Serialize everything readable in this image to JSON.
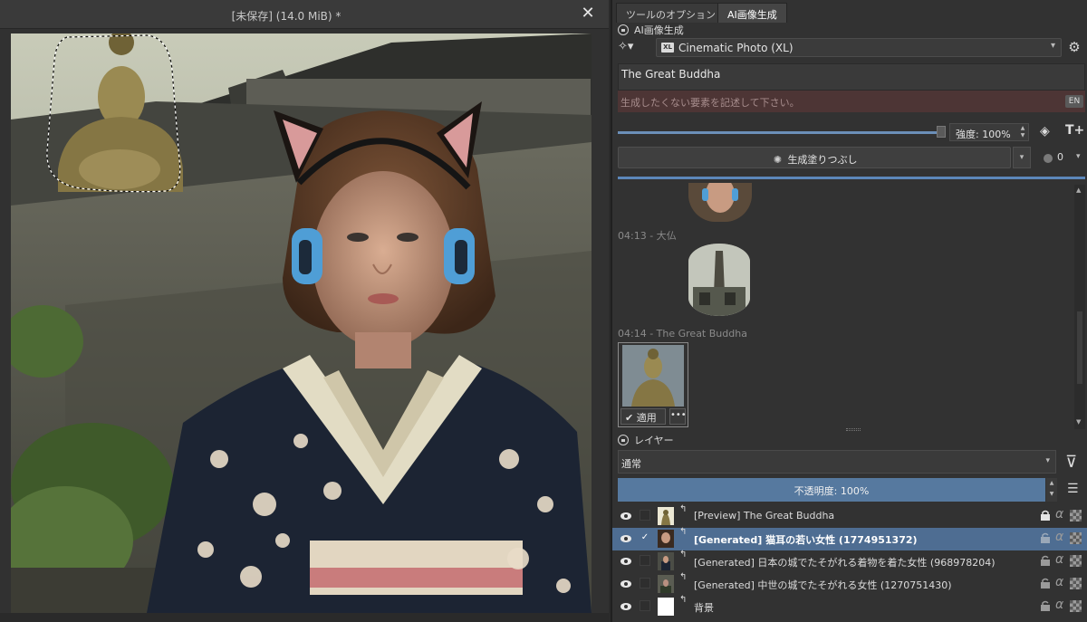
{
  "window": {
    "title": "[未保存]  (14.0 MiB) *",
    "close_glyph": "✕"
  },
  "dock": {
    "tabs": [
      {
        "label": "ツールのオプション",
        "active": false
      },
      {
        "label": "AI画像生成",
        "active": true
      }
    ]
  },
  "ai_panel": {
    "header": "AI画像生成",
    "model_badge": "XL",
    "model": "Cinematic Photo (XL)",
    "prompt": "The Great Buddha",
    "negative_placeholder": "生成したくない要素を記述して下さい。",
    "language_badge": "EN",
    "strength_label": "強度: 100%",
    "strength_value": 1.0,
    "generate_button": "生成塗りつぶし",
    "seed_count": "0",
    "history": [
      {
        "time": "04:13 - 大仏"
      },
      {
        "time": "04:14 - The Great Buddha"
      }
    ],
    "apply_button": "適用",
    "more_button": "•••"
  },
  "layers_panel": {
    "header": "レイヤー",
    "blend_mode": "通常",
    "opacity_label": "不透明度: 100%",
    "opacity_value": 1.0,
    "layers": [
      {
        "name": "[Preview] The Great Buddha",
        "selected": false,
        "locked": true
      },
      {
        "name": "[Generated] 猫耳の若い女性 (1774951372)",
        "selected": true,
        "locked": false
      },
      {
        "name": "[Generated] 日本の城でたそがれる着物を着た女性 (968978204)",
        "selected": false,
        "locked": false
      },
      {
        "name": "[Generated] 中世の城でたそがれる女性 (1270751430)",
        "selected": false,
        "locked": false
      },
      {
        "name": "背景",
        "selected": false,
        "locked": false
      }
    ]
  },
  "colors": {
    "accent": "#56799f",
    "selected_row": "#4e6d92",
    "negative_prompt_bg": "#4d3535"
  },
  "icons": {
    "wand": "magic-wand-icon",
    "gear": "gear-icon",
    "eye": "eye-icon",
    "lock": "lock-icon",
    "filter": "filter-icon",
    "menu": "hamburger-icon"
  }
}
